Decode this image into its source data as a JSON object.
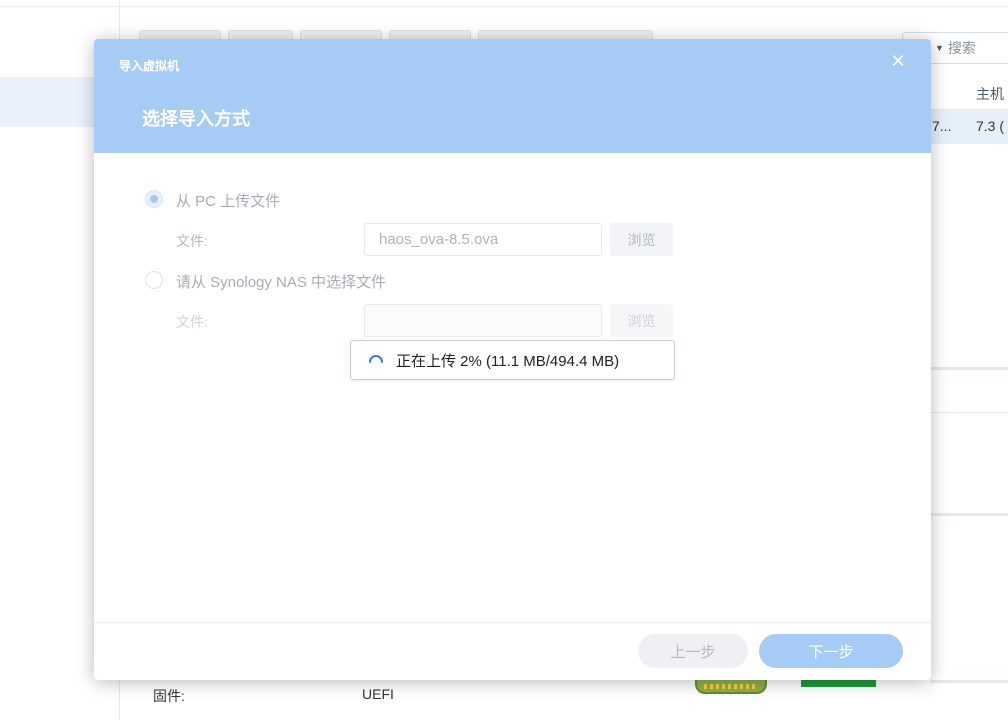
{
  "background": {
    "search_placeholder": "搜索",
    "table_header_host": "主机",
    "table_row_col1": "7...",
    "table_row_col2": "7.3 (",
    "firmware_label": "固件:",
    "firmware_value": "UEFI"
  },
  "dialog": {
    "window_title": "导入虚拟机",
    "close_icon": "close-icon",
    "step_title": "选择导入方式",
    "option_pc": {
      "label": "从 PC 上传文件",
      "selected": true,
      "file_label": "文件:",
      "file_value": "haos_ova-8.5.ova",
      "browse_label": "浏览"
    },
    "option_nas": {
      "label": "请从 Synology NAS 中选择文件",
      "selected": false,
      "file_label": "文件:",
      "file_value": "",
      "browse_label": "浏览"
    },
    "upload_status": "正在上传 2% (11.1 MB/494.4 MB)",
    "upload_progress_percent": 2,
    "prev_button": "上一步",
    "next_button": "下一步"
  },
  "colors": {
    "header_blue": "#a6cbf5",
    "selection_blue": "#e6f0fb",
    "spinner_blue": "#2f7fd6"
  }
}
